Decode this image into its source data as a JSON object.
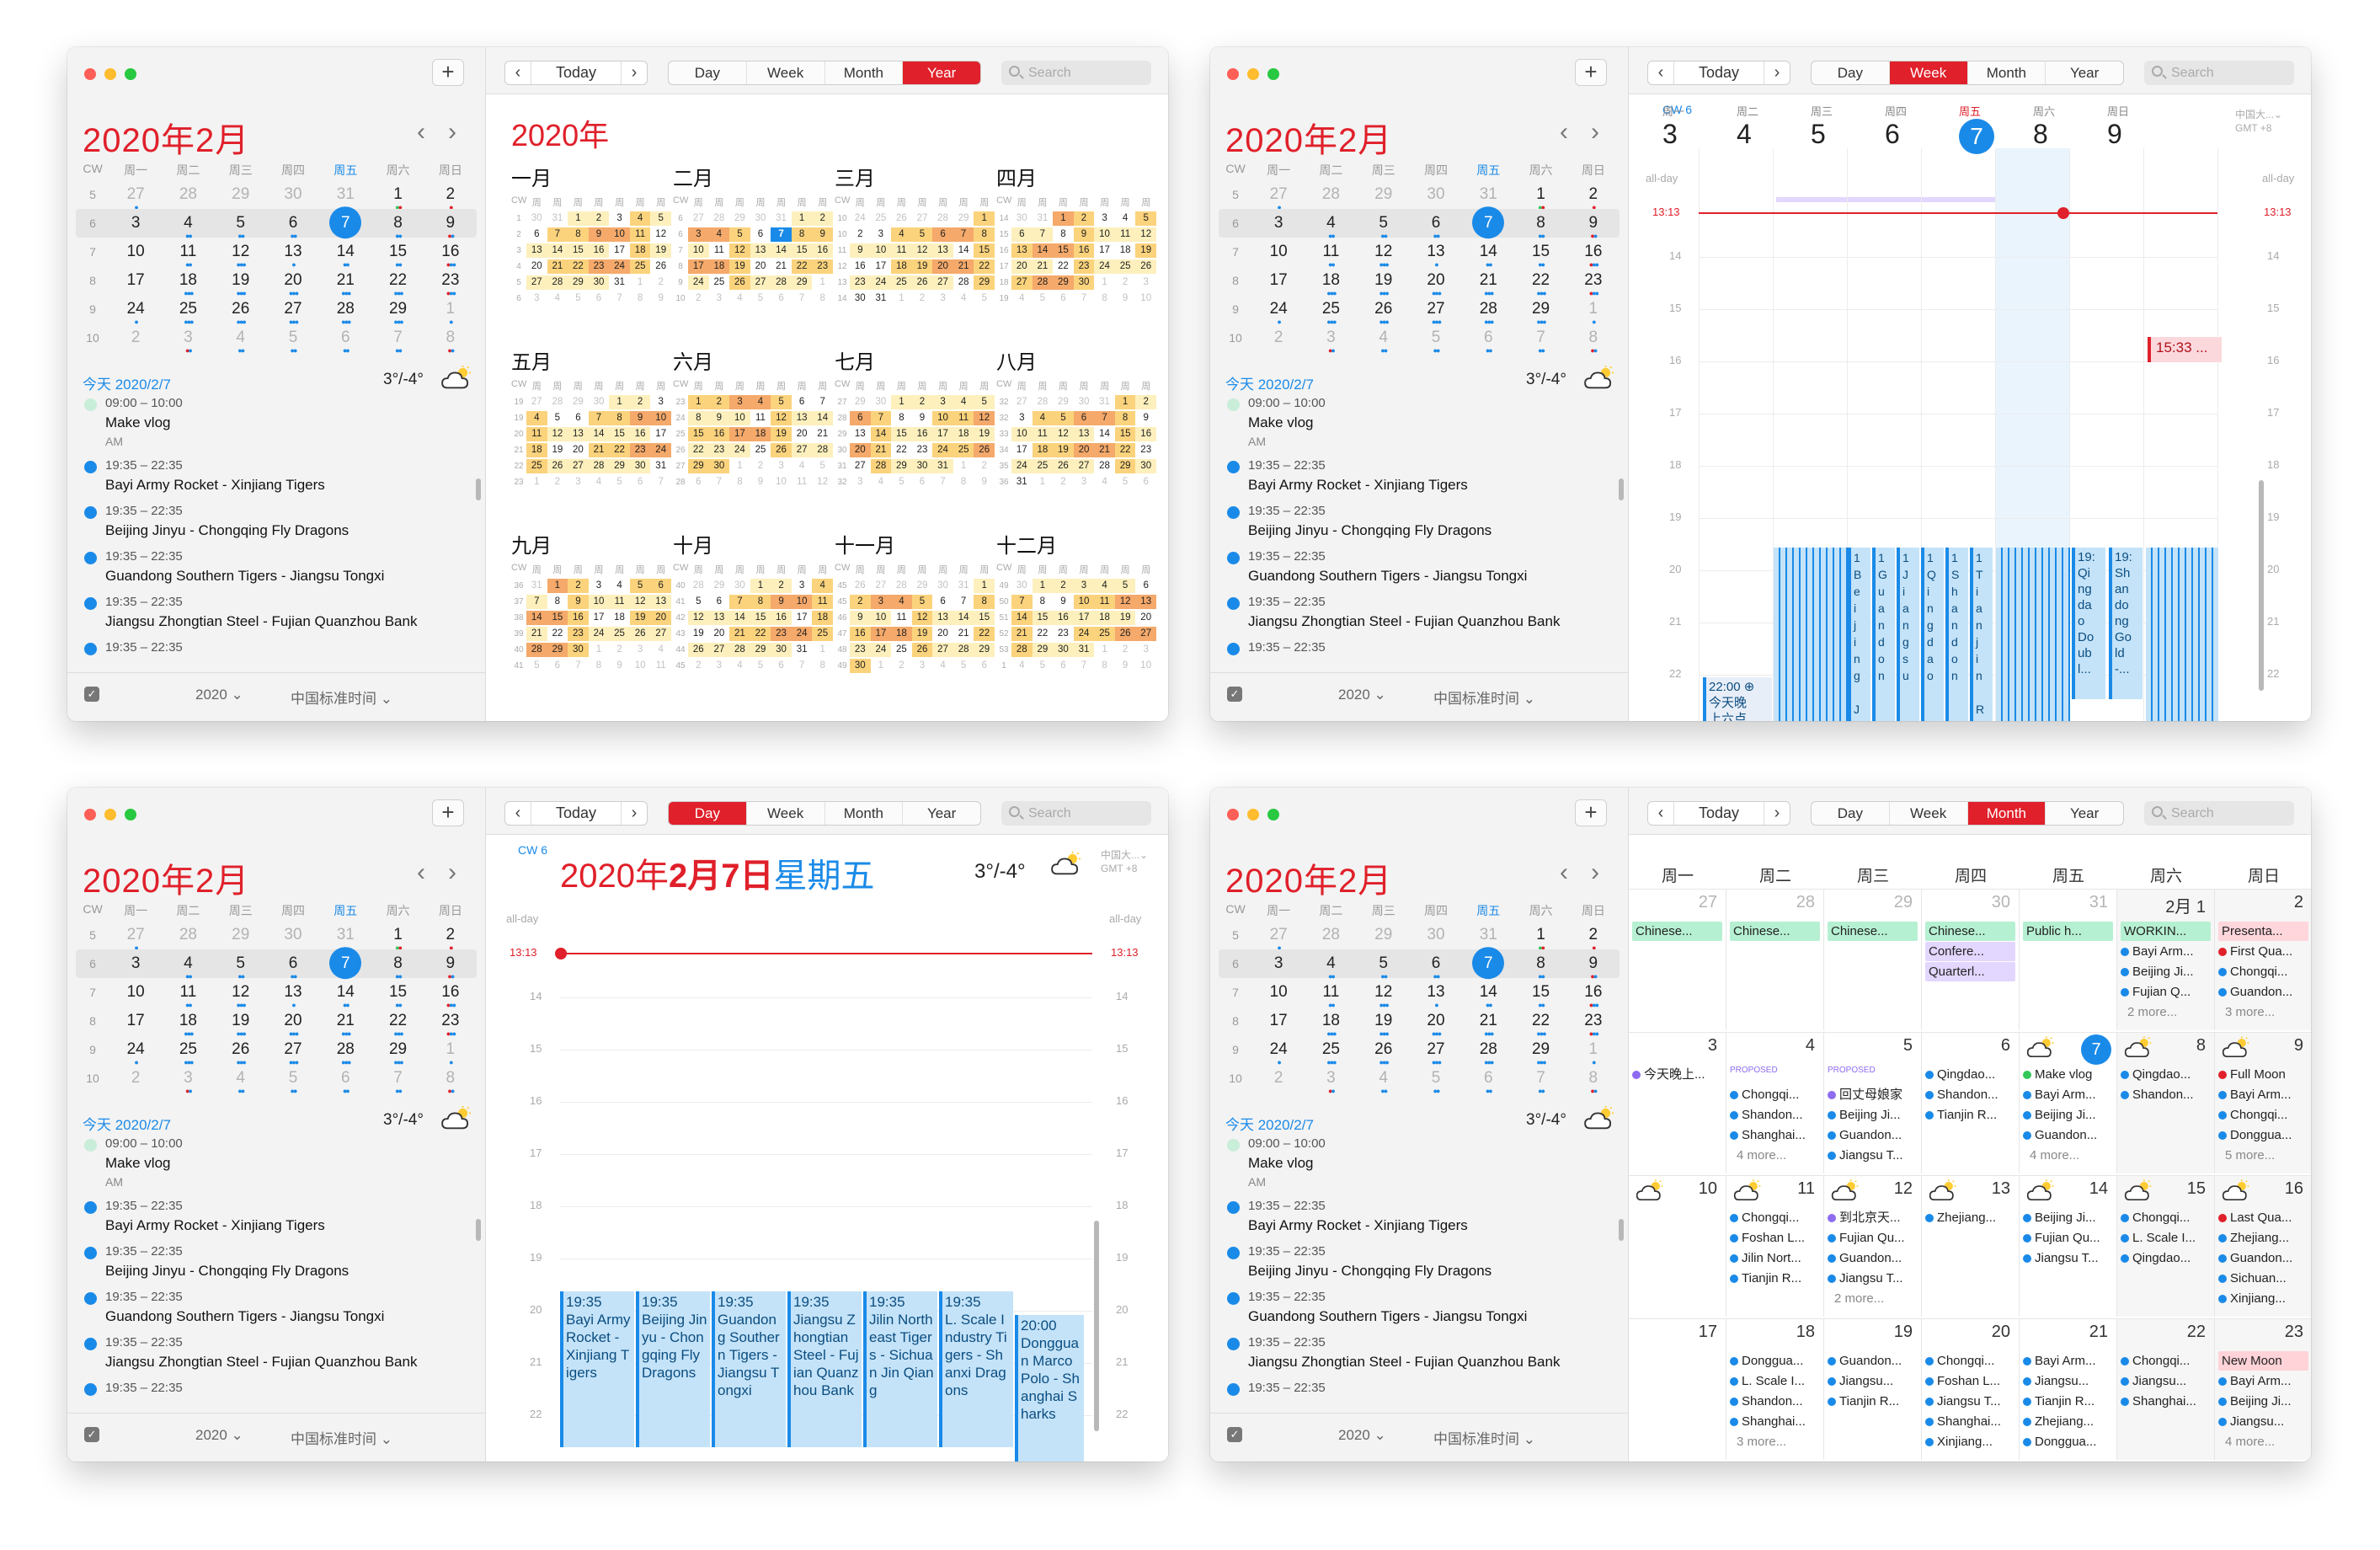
{
  "common": {
    "title": "2020年2月",
    "cw": "CW",
    "weekdays": [
      "周一",
      "周二",
      "周三",
      "周四",
      "周五",
      "周六",
      "周日"
    ],
    "today_label": "今天 2020/2/7",
    "weather": "3°/-4°",
    "footer_year": "2020 ⌄",
    "footer_tz": "中国标准时间 ⌄",
    "nav": {
      "prev": "‹",
      "today": "Today",
      "next": "›"
    },
    "views": [
      "Day",
      "Week",
      "Month",
      "Year"
    ],
    "search_placeholder": "Search",
    "mini_cal": [
      {
        "cw": "5",
        "days": [
          [
            "27",
            "g",
            "blue"
          ],
          [
            "28",
            "g",
            ""
          ],
          [
            "29",
            "g",
            ""
          ],
          [
            "30",
            "g",
            ""
          ],
          [
            "31",
            "g",
            ""
          ],
          [
            "1",
            "",
            "green red"
          ],
          [
            "2",
            "",
            "red"
          ]
        ]
      },
      {
        "cw": "6",
        "sel": true,
        "days": [
          [
            "3",
            "",
            ""
          ],
          [
            "4",
            "",
            "blue blue"
          ],
          [
            "5",
            "",
            "blue blue"
          ],
          [
            "6",
            "",
            "blue blue"
          ],
          [
            "7",
            "t",
            "blue blue"
          ],
          [
            "8",
            "",
            "blue blue"
          ],
          [
            "9",
            "",
            "red blue"
          ]
        ]
      },
      {
        "cw": "7",
        "days": [
          [
            "10",
            "",
            ""
          ],
          [
            "11",
            "",
            "blue blue"
          ],
          [
            "12",
            "",
            "blue blue blue"
          ],
          [
            "13",
            "",
            "blue"
          ],
          [
            "14",
            "",
            "blue blue"
          ],
          [
            "15",
            "",
            "blue blue"
          ],
          [
            "16",
            "",
            "red blue blue"
          ]
        ]
      },
      {
        "cw": "8",
        "days": [
          [
            "17",
            "",
            ""
          ],
          [
            "18",
            "",
            "blue blue blue"
          ],
          [
            "19",
            "",
            "blue blue blue"
          ],
          [
            "20",
            "",
            "blue blue blue"
          ],
          [
            "21",
            "",
            "blue blue blue"
          ],
          [
            "22",
            "",
            "blue blue blue"
          ],
          [
            "23",
            "",
            "red blue blue"
          ]
        ]
      },
      {
        "cw": "9",
        "days": [
          [
            "24",
            "",
            "blue"
          ],
          [
            "25",
            "",
            "blue blue blue"
          ],
          [
            "26",
            "",
            "blue blue blue"
          ],
          [
            "27",
            "",
            "blue blue blue"
          ],
          [
            "28",
            "",
            "blue blue blue"
          ],
          [
            "29",
            "",
            "blue blue blue"
          ],
          [
            "1",
            "g",
            "blue"
          ]
        ]
      },
      {
        "cw": "10",
        "days": [
          [
            "2",
            "g",
            ""
          ],
          [
            "3",
            "g",
            "red blue"
          ],
          [
            "4",
            "g",
            "blue blue"
          ],
          [
            "5",
            "g",
            "blue blue"
          ],
          [
            "6",
            "g",
            "blue blue"
          ],
          [
            "7",
            "g",
            "blue blue"
          ],
          [
            "8",
            "g",
            "red blue"
          ]
        ]
      }
    ],
    "agenda": [
      {
        "time": "09:00 – 10:00",
        "name": "Make vlog",
        "meta": "AM",
        "color": "#c8edd8"
      },
      {
        "time": "19:35 – 22:35",
        "name": "Bayi Army Rocket - Xinjiang Tigers",
        "color": "#1a8ae8"
      },
      {
        "time": "19:35 – 22:35",
        "name": "Beijing Jinyu - Chongqing Fly Dragons",
        "color": "#1a8ae8"
      },
      {
        "time": "19:35 – 22:35",
        "name": "Guandong Southern Tigers - Jiangsu Tongxi",
        "color": "#1a8ae8"
      },
      {
        "time": "19:35 – 22:35",
        "name": "Jiangsu Zhongtian Steel - Fujian Quanzhou Bank",
        "color": "#1a8ae8"
      },
      {
        "time": "19:35 – 22:35",
        "name": "Jilin Northeast Tigers - Sichuan Jin Qiang",
        "color": "#1a8ae8"
      }
    ]
  },
  "year_view": {
    "title": "2020年",
    "months": [
      "一月",
      "二月",
      "三月",
      "四月",
      "五月",
      "六月",
      "七月",
      "八月",
      "九月",
      "十月",
      "十一月",
      "十二月"
    ]
  },
  "week_view": {
    "cw": "CW 6",
    "days": [
      {
        "l": "周一",
        "n": "3"
      },
      {
        "l": "周二",
        "n": "4"
      },
      {
        "l": "周三",
        "n": "5"
      },
      {
        "l": "周四",
        "n": "6"
      },
      {
        "l": "周五",
        "n": "7"
      },
      {
        "l": "周六",
        "n": "8"
      },
      {
        "l": "周日",
        "n": "9"
      }
    ],
    "tz": "中国大...⌄\nGMT +8",
    "allday": "all-day",
    "now": "13:13",
    "hours": [
      "14",
      "15",
      "16",
      "17",
      "18",
      "19",
      "20",
      "21",
      "22"
    ],
    "pink_event": "15:33 ...",
    "games": [
      "Beijing J",
      "Guandon",
      "Jiangsu",
      "Qingdao",
      "Shandon",
      "Tianjin R"
    ],
    "late1": "19:\nQi\nng\nda\no\nDo\nub\nl...",
    "late2": "19:\nSh\nan\ndo\nng\nGo\nld\n-...",
    "bottom_event": "22:00 ⊕\n今天晚\n上六点"
  },
  "day_view": {
    "cw": "CW 6",
    "title_a": "2020年",
    "title_b": "2月7日",
    "title_c": "星期五",
    "tz": "中国大...⌄\nGMT +8",
    "allday": "all-day",
    "now": "13:13",
    "hours": [
      "14",
      "15",
      "16",
      "17",
      "18",
      "19",
      "20",
      "21",
      "22"
    ],
    "events": [
      "19:35\nBayi Army Rocket - Xinjiang Tigers",
      "19:35\nBeijing Jinyu - Chongqing Fly Dragons",
      "19:35\nGuandong Southern Tigers - Jiangsu Tongxi",
      "19:35\nJiangsu Zhongtian Steel - Fujian Quanzhou Bank",
      "19:35\nJilin Northeast Tigers - Sichuan Jin Qiang",
      "19:35\nL. Scale Industry Tigers - Shanxi Dragons",
      "20:00\nDongguan Marco Polo - Shanghai Sharks"
    ]
  },
  "month_view": {
    "weeks": [
      [
        {
          "n": "27",
          "g": true,
          "ev": [
            [
              "bar",
              "Chinese..."
            ]
          ]
        },
        {
          "n": "28",
          "g": true,
          "ev": [
            [
              "bar",
              "Chinese..."
            ]
          ]
        },
        {
          "n": "29",
          "g": true,
          "ev": [
            [
              "bar",
              "Chinese..."
            ]
          ]
        },
        {
          "n": "30",
          "g": true,
          "ev": [
            [
              "bar",
              "Chinese..."
            ],
            [
              "bar2",
              "Confere..."
            ],
            [
              "bar2",
              "Quarterl..."
            ]
          ]
        },
        {
          "n": "31",
          "g": true,
          "ev": [
            [
              "bar",
              "Public h..."
            ]
          ]
        },
        {
          "n": "2月 1",
          "we": true,
          "ev": [
            [
              "bar",
              "WORKIN..."
            ],
            [
              "dot",
              "Bayi Arm..."
            ],
            [
              "dot",
              "Beijing Ji..."
            ],
            [
              "dot",
              "Fujian Q..."
            ],
            [
              "more",
              "2 more..."
            ]
          ]
        },
        {
          "n": "2",
          "we": true,
          "ev": [
            [
              "bar3",
              "Presenta..."
            ],
            [
              "dotr",
              "First Qua..."
            ],
            [
              "dot",
              "Chongqi..."
            ],
            [
              "dot",
              "Guandon..."
            ],
            [
              "more",
              "3 more..."
            ]
          ]
        }
      ],
      [
        {
          "n": "3",
          "ev": [
            [
              "dotp",
              "今天晚上..."
            ]
          ]
        },
        {
          "n": "4",
          "ev": [
            [
              "prop",
              "PROPOSED"
            ],
            [
              "dot",
              "Chongqi..."
            ],
            [
              "dot",
              "Shandon..."
            ],
            [
              "dot",
              "Shanghai..."
            ],
            [
              "more",
              "4 more..."
            ]
          ]
        },
        {
          "n": "5",
          "ev": [
            [
              "prop",
              "PROPOSED"
            ],
            [
              "dotp",
              "回丈母娘家"
            ],
            [
              "dot",
              "Beijing Ji..."
            ],
            [
              "dot",
              "Guandon..."
            ],
            [
              "dot",
              "Jiangsu T..."
            ]
          ]
        },
        {
          "n": "6",
          "ev": [
            [
              "dot",
              "Qingdao..."
            ],
            [
              "dot",
              "Shandon..."
            ],
            [
              "dot",
              "Tianjin R..."
            ]
          ]
        },
        {
          "n": "7",
          "t": true,
          "wx": true,
          "ev": [
            [
              "dotg",
              "Make vlog"
            ],
            [
              "dot",
              "Bayi Arm..."
            ],
            [
              "dot",
              "Beijing Ji..."
            ],
            [
              "dot",
              "Guandon..."
            ],
            [
              "more",
              "4 more..."
            ]
          ]
        },
        {
          "n": "8",
          "we": true,
          "wx": true,
          "ev": [
            [
              "dot",
              "Qingdao..."
            ],
            [
              "dot",
              "Shandon..."
            ]
          ]
        },
        {
          "n": "9",
          "we": true,
          "wx": true,
          "ev": [
            [
              "dotr",
              "Full Moon"
            ],
            [
              "dot",
              "Bayi Arm..."
            ],
            [
              "dot",
              "Chongqi..."
            ],
            [
              "dot",
              "Donggua..."
            ],
            [
              "more",
              "5 more..."
            ]
          ]
        }
      ],
      [
        {
          "n": "10",
          "wx": true,
          "ev": []
        },
        {
          "n": "11",
          "wx": true,
          "ev": [
            [
              "dot",
              "Chongqi..."
            ],
            [
              "dot",
              "Foshan L..."
            ],
            [
              "dot",
              "Jilin Nort..."
            ],
            [
              "dot",
              "Tianjin R..."
            ]
          ]
        },
        {
          "n": "12",
          "wx": true,
          "ev": [
            [
              "dotp",
              "到北京天..."
            ],
            [
              "dot",
              "Fujian Qu..."
            ],
            [
              "dot",
              "Guandon..."
            ],
            [
              "dot",
              "Jiangsu T..."
            ],
            [
              "more",
              "2 more..."
            ]
          ]
        },
        {
          "n": "13",
          "wx": true,
          "ev": [
            [
              "dot",
              "Zhejiang..."
            ]
          ]
        },
        {
          "n": "14",
          "wx": true,
          "ev": [
            [
              "dot",
              "Beijing Ji..."
            ],
            [
              "dot",
              "Fujian Qu..."
            ],
            [
              "dot",
              "Jiangsu T..."
            ]
          ]
        },
        {
          "n": "15",
          "we": true,
          "wx": true,
          "ev": [
            [
              "dot",
              "Chongqi..."
            ],
            [
              "dot",
              "L. Scale I..."
            ],
            [
              "dot",
              "Qingdao..."
            ]
          ]
        },
        {
          "n": "16",
          "we": true,
          "wx": true,
          "ev": [
            [
              "dotr",
              "Last Qua..."
            ],
            [
              "dot",
              "Zhejiang..."
            ],
            [
              "dot",
              "Guandon..."
            ],
            [
              "dot",
              "Sichuan..."
            ],
            [
              "dot",
              "Xinjiang..."
            ]
          ]
        }
      ],
      [
        {
          "n": "17",
          "ev": []
        },
        {
          "n": "18",
          "ev": [
            [
              "dot",
              "Donggua..."
            ],
            [
              "dot",
              "L. Scale I..."
            ],
            [
              "dot",
              "Shandon..."
            ],
            [
              "dot",
              "Shanghai..."
            ],
            [
              "more",
              "3 more..."
            ]
          ]
        },
        {
          "n": "19",
          "ev": [
            [
              "dot",
              "Guandon..."
            ],
            [
              "dot",
              "Jiangsu..."
            ],
            [
              "dot",
              "Tianjin R..."
            ]
          ]
        },
        {
          "n": "20",
          "ev": [
            [
              "dot",
              "Chongqi..."
            ],
            [
              "dot",
              "Foshan L..."
            ],
            [
              "dot",
              "Jiangsu T..."
            ],
            [
              "dot",
              "Shanghai..."
            ],
            [
              "dot",
              "Xinjiang..."
            ]
          ]
        },
        {
          "n": "21",
          "ev": [
            [
              "dot",
              "Bayi Arm..."
            ],
            [
              "dot",
              "Jiangsu..."
            ],
            [
              "dot",
              "Tianjin R..."
            ],
            [
              "dot",
              "Zhejiang..."
            ],
            [
              "dot",
              "Donggua..."
            ]
          ]
        },
        {
          "n": "22",
          "we": true,
          "ev": [
            [
              "dot",
              "Chongqi..."
            ],
            [
              "dot",
              "Jiangsu..."
            ],
            [
              "dot",
              "Shanghai..."
            ]
          ]
        },
        {
          "n": "23",
          "we": true,
          "ev": [
            [
              "bar4",
              "New Moon"
            ],
            [
              "dot",
              "Bayi Arm..."
            ],
            [
              "dot",
              "Beijing Ji..."
            ],
            [
              "dot",
              "Jiangsu..."
            ],
            [
              "more",
              "4 more..."
            ]
          ]
        }
      ]
    ]
  }
}
